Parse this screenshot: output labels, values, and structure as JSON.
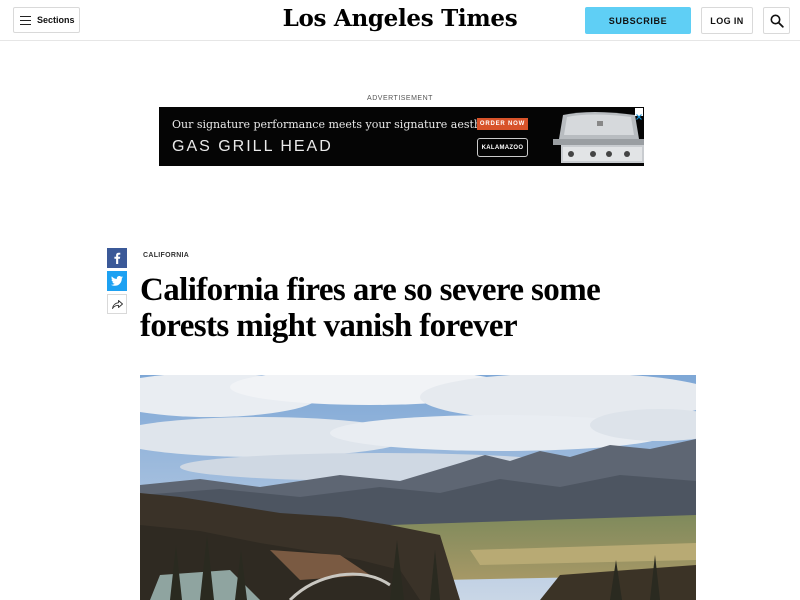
{
  "header": {
    "sections_label": "Sections",
    "masthead": "Los Angeles Times",
    "subscribe_label": "SUBSCRIBE",
    "login_label": "LOG IN"
  },
  "ad": {
    "label": "ADVERTISEMENT",
    "line1": "Our signature performance meets your signature aesthetic.",
    "line2": "GAS GRILL HEAD",
    "cta": "ORDER NOW",
    "brand": "KALAMAZOO"
  },
  "article": {
    "kicker": "CALIFORNIA",
    "headline": "California fires are so severe some forests might vanish forever"
  },
  "colors": {
    "accent": "#5fcff5",
    "facebook": "#3b5998",
    "twitter": "#1da1f2",
    "ad_cta": "#d8532a"
  },
  "icons": [
    "hamburger-icon",
    "search-icon",
    "facebook-icon",
    "twitter-icon",
    "share-icon",
    "ad-close-icon"
  ]
}
